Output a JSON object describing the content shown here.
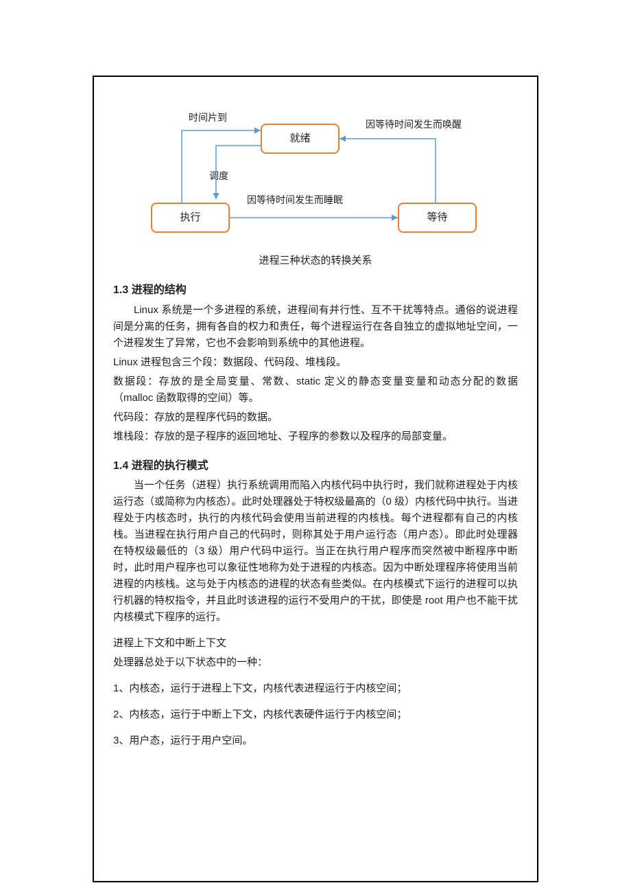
{
  "diagram": {
    "boxes": {
      "ready": "就绪",
      "running": "执行",
      "waiting": "等待"
    },
    "labels": {
      "timeslice": "时间片到",
      "schedule": "调度",
      "wakeup": "因等待时间发生而唤醒",
      "sleep": "因等待时间发生而睡眠"
    },
    "caption": "进程三种状态的转换关系"
  },
  "section13": {
    "heading": "1.3  进程的结构",
    "p1": "Linux 系统是一个多进程的系统，进程间有并行性、互不干扰等特点。通俗的说进程间是分离的任务，拥有各自的权力和责任，每个进程运行在各自独立的虚拟地址空间，一个进程发生了异常，它也不会影响到系统中的其他进程。",
    "p2": "Linux 进程包含三个段：数据段、代码段、堆栈段。",
    "p3": "数据段：存放的是全局变量、常数、static 定义的静态变量变量和动态分配的数据（malloc 函数取得的空间）等。",
    "p4": "代码段：存放的是程序代码的数据。",
    "p5": "堆栈段：存放的是子程序的返回地址、子程序的参数以及程序的局部变量。"
  },
  "section14": {
    "heading": "1.4  进程的执行模式",
    "p1": "当一个任务（进程）执行系统调用而陷入内核代码中执行时，我们就称进程处于内核运行态（或简称为内核态）。此时处理器处于特权级最高的（0 级）内核代码中执行。当进程处于内核态时，执行的内核代码会使用当前进程的内核栈。每个进程都有自己的内核栈。当进程在执行用户自己的代码时，则称其处于用户运行态（用户态）。即此时处理器在特权级最低的（3 级）用户代码中运行。当正在执行用户程序而突然被中断程序中断时，此时用户程序也可以象征性地称为处于进程的内核态。因为中断处理程序将使用当前进程的内核栈。这与处于内核态的进程的状态有些类似。在内核模式下运行的进程可以执行机器的特权指令，并且此时该进程的运行不受用户的干扰，即使是 root 用户也不能干扰内核模式下程序的运行。",
    "p2": "进程上下文和中断上下文",
    "p3": "处理器总处于以下状态中的一种：",
    "p4": "1、内核态，运行于进程上下文，内核代表进程运行于内核空间；",
    "p5": "2、内核态，运行于中断上下文，内核代表硬件运行于内核空间；",
    "p6": "3、用户态，运行于用户空间。"
  }
}
